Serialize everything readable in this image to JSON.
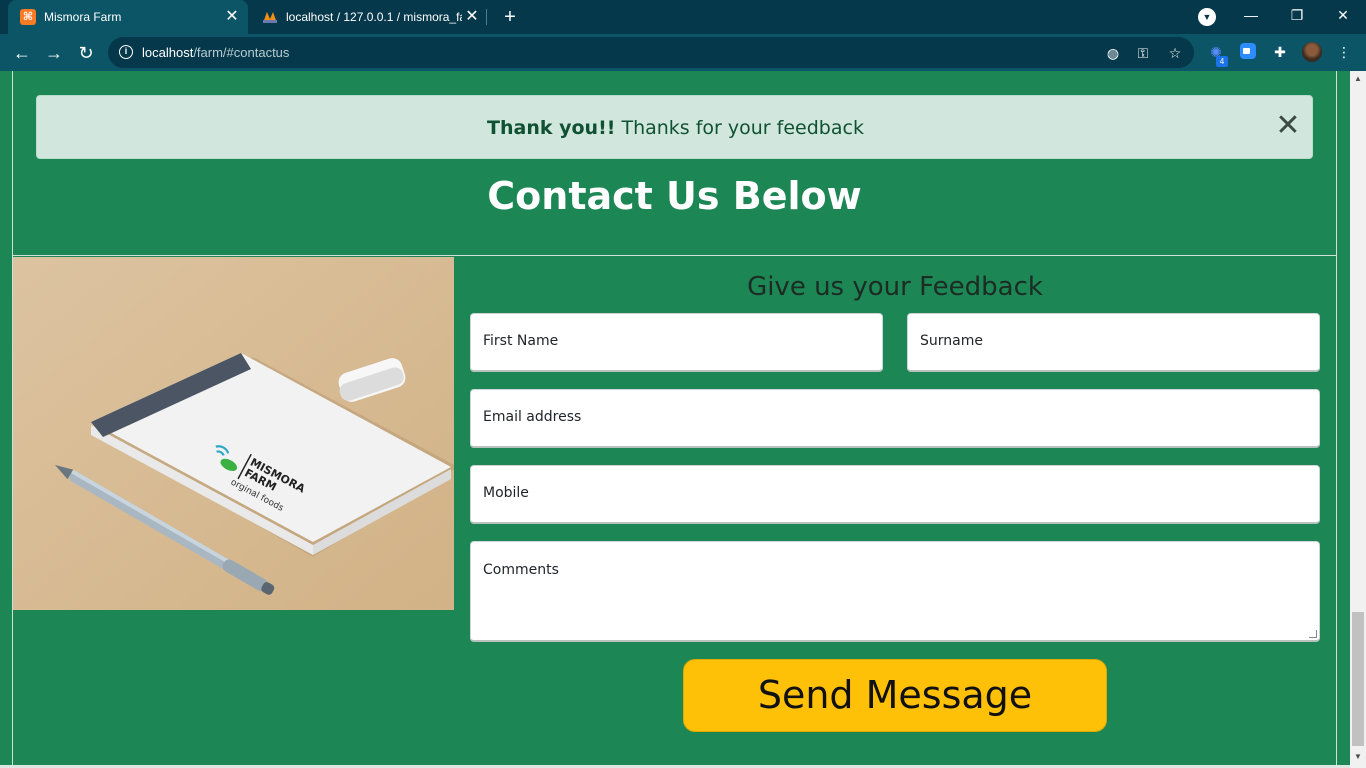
{
  "browser": {
    "tabs": [
      {
        "title": "Mismora Farm",
        "favicon": "xampp-icon",
        "active": true
      },
      {
        "title": "localhost / 127.0.0.1 / mismora_fa",
        "favicon": "phpmyadmin-icon",
        "active": false
      }
    ],
    "url_host": "localhost",
    "url_path": "/farm/#contactus",
    "window_controls": {
      "minimize": "—",
      "restore": "❐",
      "close": "✕"
    },
    "extension_badge": "4"
  },
  "alert": {
    "strong": "Thank you!!",
    "message": " Thanks for your feedback",
    "close_glyph": "✕"
  },
  "section": {
    "title": "Contact Us Below"
  },
  "photo": {
    "logo_line1": "MISMORA",
    "logo_line2": "FARM",
    "logo_tagline": "orginal foods"
  },
  "form": {
    "title": "Give us your Feedback",
    "first_name_placeholder": "First Name",
    "surname_placeholder": "Surname",
    "email_placeholder": "Email address",
    "mobile_placeholder": "Mobile",
    "comments_placeholder": "Comments",
    "submit_label": "Send Message"
  },
  "colors": {
    "page_green": "#1c8755",
    "alert_bg": "#d1e7dd",
    "alert_text": "#0f5132",
    "button_yellow": "#ffc107",
    "chrome_dark": "#05384a",
    "chrome_toolbar": "#0b5566"
  }
}
